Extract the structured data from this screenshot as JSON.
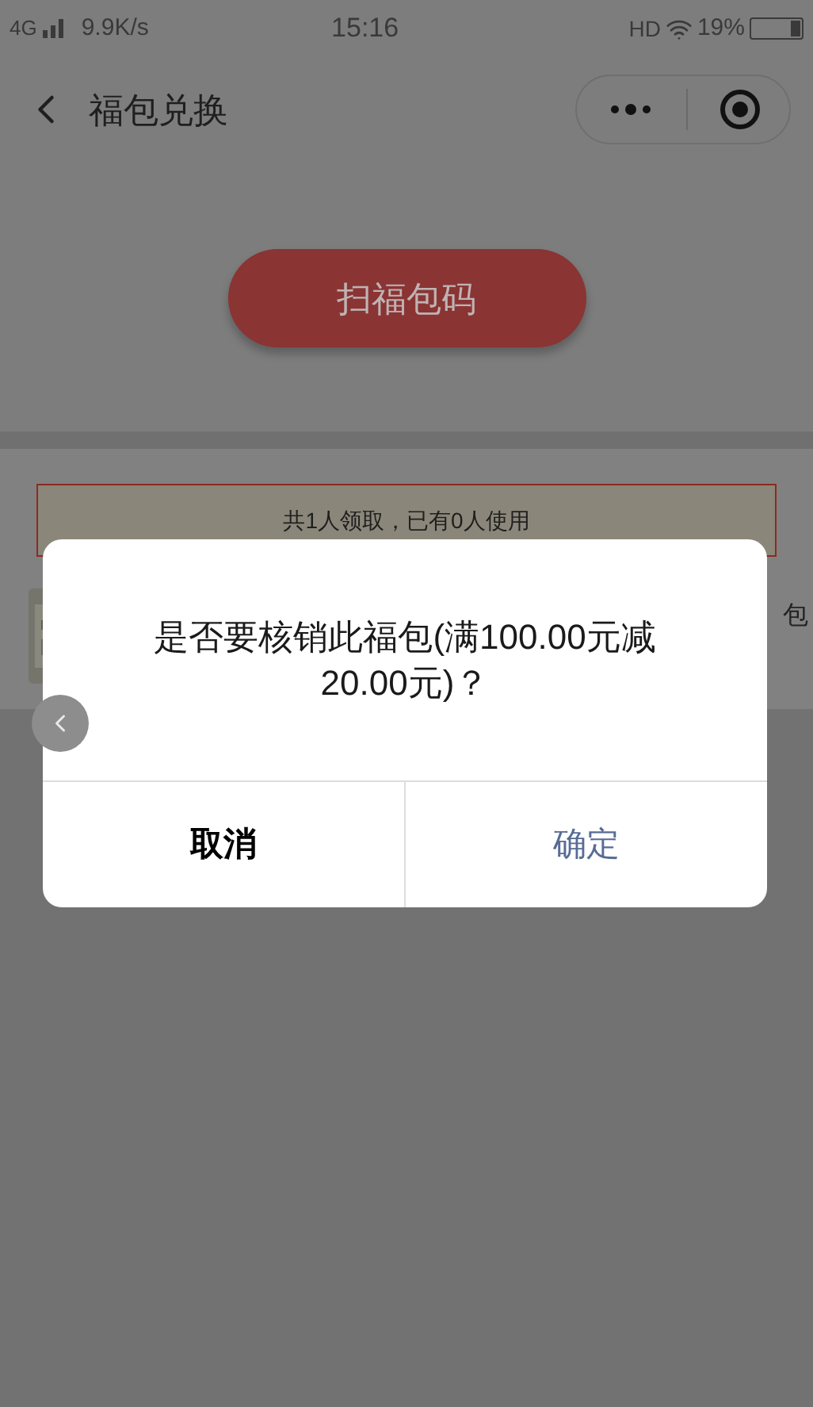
{
  "status_bar": {
    "network": "4G",
    "speed": "9.9K/s",
    "time": "15:16",
    "hd": "HD",
    "battery": "19%"
  },
  "nav": {
    "title": "福包兑换"
  },
  "scan_button": {
    "label": "扫福包码"
  },
  "summary": {
    "text": "共1人领取，已有0人使用"
  },
  "list_item": {
    "kind": "picture",
    "trailing_text": "包"
  },
  "dialog": {
    "message": "是否要核销此福包(满100.00元减20.00元)？",
    "buttons": [
      {
        "label": "取消",
        "kind": "cancel"
      },
      {
        "label": "确定",
        "kind": "confirm"
      }
    ]
  }
}
